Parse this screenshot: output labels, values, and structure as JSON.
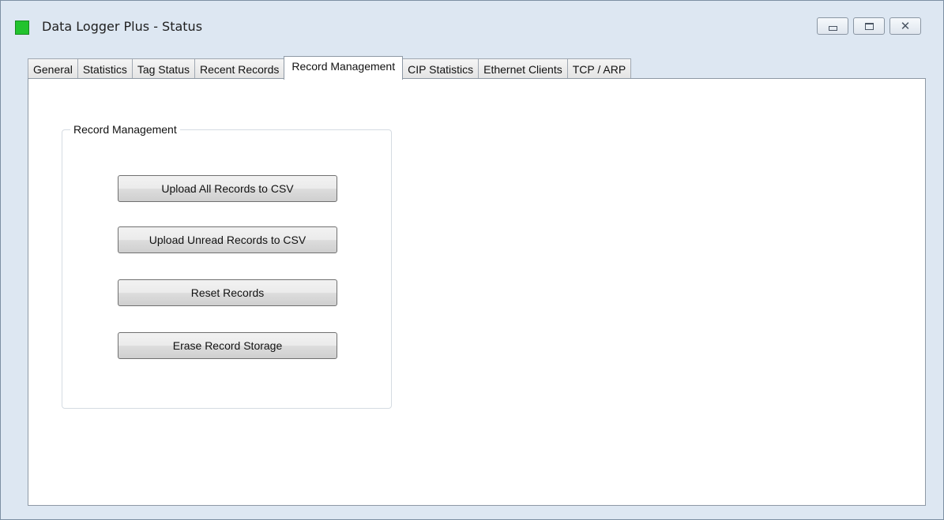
{
  "window": {
    "title": "Data Logger Plus - Status",
    "icon": "green-status-square-icon",
    "controls": {
      "minimize": "minimize-icon",
      "maximize": "maximize-icon",
      "close": "close-icon"
    }
  },
  "tabs": [
    {
      "label": "General"
    },
    {
      "label": "Statistics"
    },
    {
      "label": "Tag Status"
    },
    {
      "label": "Recent Records"
    },
    {
      "label": "Record Management",
      "active": true
    },
    {
      "label": "CIP Statistics"
    },
    {
      "label": "Ethernet Clients"
    },
    {
      "label": "TCP / ARP"
    }
  ],
  "record_management": {
    "group_title": "Record Management",
    "buttons": {
      "upload_all": "Upload All Records to CSV",
      "upload_unread": "Upload Unread Records to CSV",
      "reset": "Reset Records",
      "erase": "Erase Record Storage"
    }
  },
  "colors": {
    "status_icon": "#22c32e",
    "window_frame": "#dde7f2"
  }
}
